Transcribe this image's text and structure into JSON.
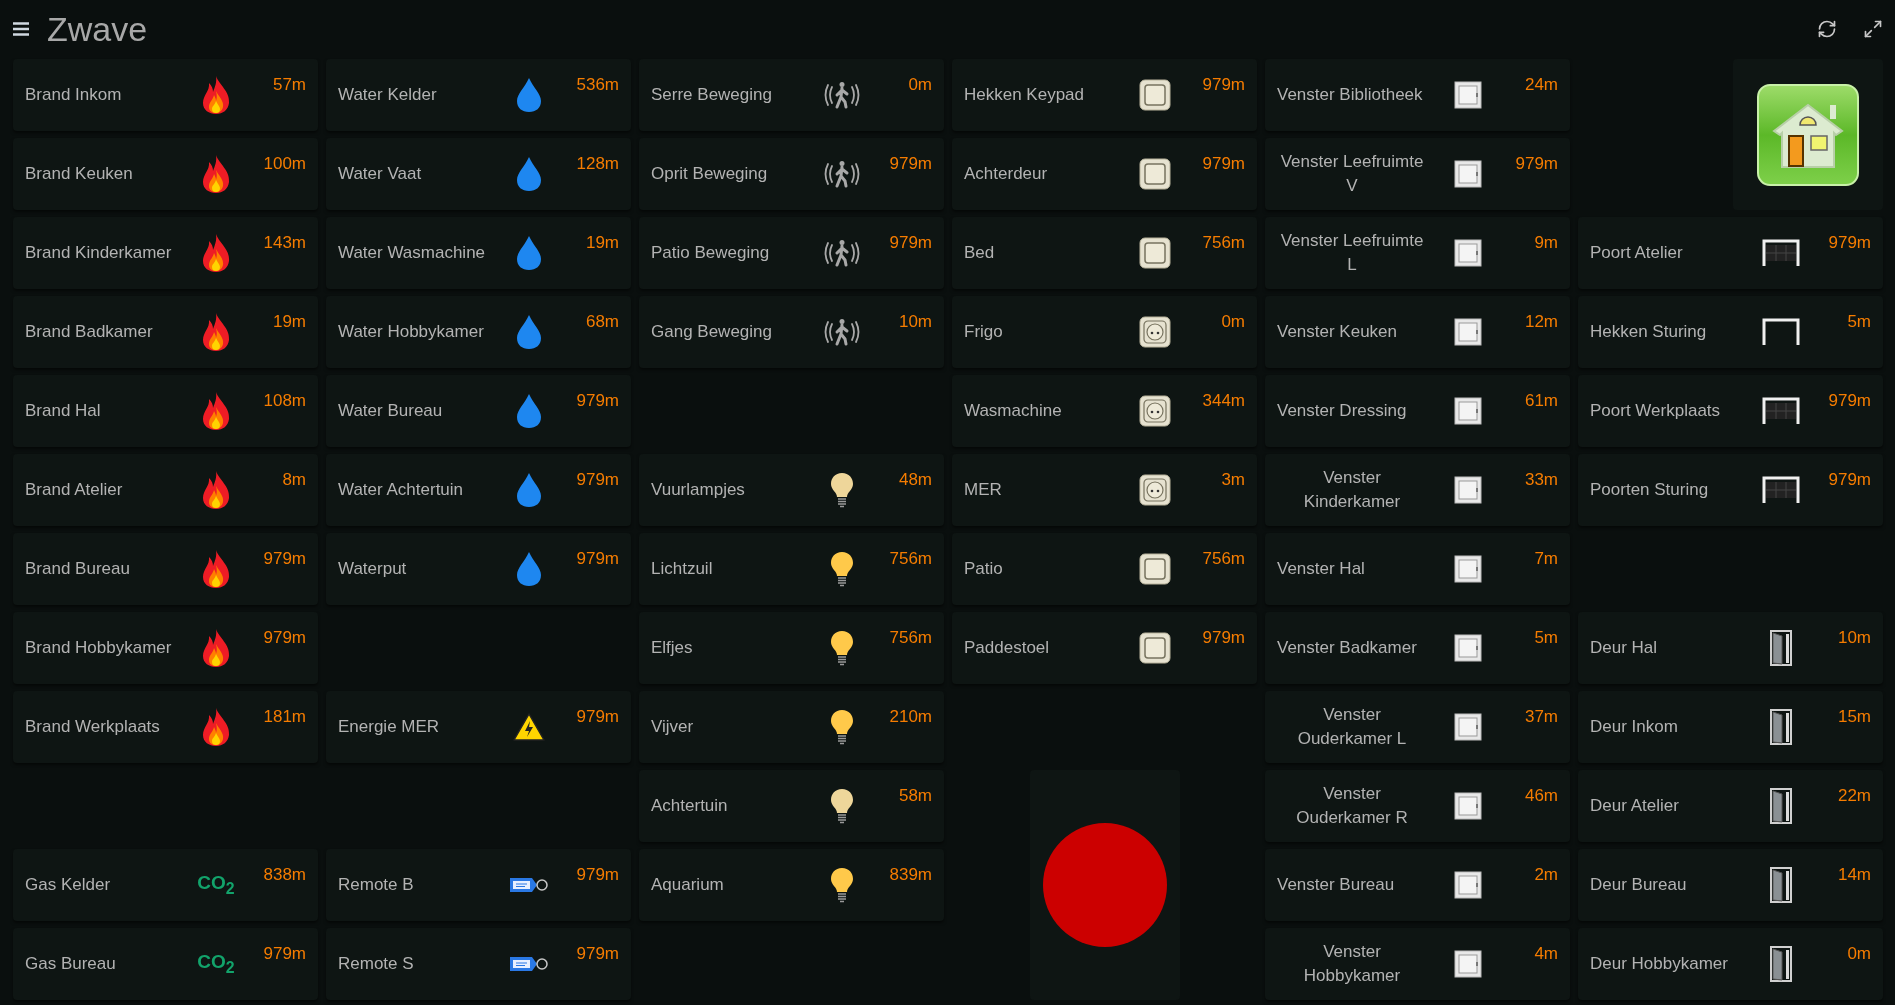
{
  "header": {
    "title": "Zwave"
  },
  "columns": [
    {
      "tiles": [
        {
          "kind": "fire",
          "name": "Brand Inkom",
          "value": "57m"
        },
        {
          "kind": "fire",
          "name": "Brand Keuken",
          "value": "100m"
        },
        {
          "kind": "fire",
          "name": "Brand Kinderkamer",
          "value": "143m"
        },
        {
          "kind": "fire",
          "name": "Brand Badkamer",
          "value": "19m"
        },
        {
          "kind": "fire",
          "name": "Brand Hal",
          "value": "108m"
        },
        {
          "kind": "fire",
          "name": "Brand Atelier",
          "value": "8m"
        },
        {
          "kind": "fire",
          "name": "Brand Bureau",
          "value": "979m"
        },
        {
          "kind": "fire",
          "name": "Brand Hobbykamer",
          "value": "979m"
        },
        {
          "kind": "fire",
          "name": "Brand Werkplaats",
          "value": "181m"
        },
        {
          "kind": "blank"
        },
        {
          "kind": "co2",
          "name": "Gas Kelder",
          "value": "838m",
          "icon_text": "CO$_{2}$"
        },
        {
          "kind": "co2",
          "name": "Gas Bureau",
          "value": "979m",
          "icon_text": "CO$_{2}$"
        }
      ]
    },
    {
      "tiles": [
        {
          "kind": "water",
          "name": "Water Kelder",
          "value": "536m"
        },
        {
          "kind": "water",
          "name": "Water Vaat",
          "value": "128m"
        },
        {
          "kind": "water",
          "name": "Water Wasmachine",
          "value": "19m"
        },
        {
          "kind": "water",
          "name": "Water Hobbykamer",
          "value": "68m"
        },
        {
          "kind": "water",
          "name": "Water Bureau",
          "value": "979m"
        },
        {
          "kind": "water",
          "name": "Water Achtertuin",
          "value": "979m"
        },
        {
          "kind": "water",
          "name": "Waterput",
          "value": "979m"
        },
        {
          "kind": "blank"
        },
        {
          "kind": "energy",
          "name": "Energie MER",
          "value": "979m"
        },
        {
          "kind": "blank"
        },
        {
          "kind": "remote",
          "name": "Remote B",
          "value": "979m"
        },
        {
          "kind": "remote",
          "name": "Remote S",
          "value": "979m"
        }
      ]
    },
    {
      "tiles": [
        {
          "kind": "motion",
          "name": "Serre Beweging",
          "value": "0m"
        },
        {
          "kind": "motion",
          "name": "Oprit Beweging",
          "value": "979m"
        },
        {
          "kind": "motion",
          "name": "Patio Beweging",
          "value": "979m"
        },
        {
          "kind": "motion",
          "name": "Gang Beweging",
          "value": "10m"
        },
        {
          "kind": "blank"
        },
        {
          "kind": "bulb",
          "name": "Vuurlampjes",
          "value": "48m",
          "on": false
        },
        {
          "kind": "bulb",
          "name": "Lichtzuil",
          "value": "756m",
          "on": true
        },
        {
          "kind": "bulb",
          "name": "Elfjes",
          "value": "756m",
          "on": true
        },
        {
          "kind": "bulb",
          "name": "Vijver",
          "value": "210m",
          "on": true
        },
        {
          "kind": "bulb",
          "name": "Achtertuin",
          "value": "58m",
          "on": false
        },
        {
          "kind": "bulb",
          "name": "Aquarium",
          "value": "839m",
          "on": true
        }
      ]
    },
    {
      "tiles": [
        {
          "kind": "switch",
          "name": "Hekken Keypad",
          "value": "979m"
        },
        {
          "kind": "switch",
          "name": "Achterdeur",
          "value": "979m"
        },
        {
          "kind": "switch",
          "name": "Bed",
          "value": "756m"
        },
        {
          "kind": "socket",
          "name": "Frigo",
          "value": "0m"
        },
        {
          "kind": "socket",
          "name": "Wasmachine",
          "value": "344m"
        },
        {
          "kind": "socket",
          "name": "MER",
          "value": "3m"
        },
        {
          "kind": "switch",
          "name": "Patio",
          "value": "756m"
        },
        {
          "kind": "switch",
          "name": "Paddestoel",
          "value": "979m"
        },
        {
          "kind": "blank"
        },
        {
          "kind": "alarm"
        }
      ]
    },
    {
      "tiles": [
        {
          "kind": "window",
          "name": "Venster Bibliotheek",
          "value": "24m"
        },
        {
          "kind": "window",
          "name": "Venster Leefruimte V",
          "value": "979m"
        },
        {
          "kind": "window",
          "name": "Venster Leefruimte L",
          "value": "9m"
        },
        {
          "kind": "window",
          "name": "Venster Keuken",
          "value": "12m"
        },
        {
          "kind": "window",
          "name": "Venster Dressing",
          "value": "61m"
        },
        {
          "kind": "window",
          "name": "Venster Kinderkamer",
          "value": "33m"
        },
        {
          "kind": "window",
          "name": "Venster Hal",
          "value": "7m"
        },
        {
          "kind": "window",
          "name": "Venster Badkamer",
          "value": "5m"
        },
        {
          "kind": "window",
          "name": "Venster Ouderkamer L",
          "value": "37m"
        },
        {
          "kind": "window",
          "name": "Venster Ouderkamer R",
          "value": "46m"
        },
        {
          "kind": "window",
          "name": "Venster Bureau",
          "value": "2m"
        },
        {
          "kind": "window",
          "name": "Venster Hobbykamer",
          "value": "4m"
        }
      ]
    },
    {
      "tiles": [
        {
          "kind": "home"
        },
        {
          "kind": "garage",
          "name": "Poort Atelier",
          "value": "979m"
        },
        {
          "kind": "gate",
          "name": "Hekken Sturing",
          "value": "5m"
        },
        {
          "kind": "garage",
          "name": "Poort Werkplaats",
          "value": "979m"
        },
        {
          "kind": "garage",
          "name": "Poorten Sturing",
          "value": "979m"
        },
        {
          "kind": "blank"
        },
        {
          "kind": "door",
          "name": "Deur Hal",
          "value": "10m"
        },
        {
          "kind": "door",
          "name": "Deur Inkom",
          "value": "15m"
        },
        {
          "kind": "door",
          "name": "Deur Atelier",
          "value": "22m"
        },
        {
          "kind": "door",
          "name": "Deur Bureau",
          "value": "14m"
        },
        {
          "kind": "door",
          "name": "Deur Hobbykamer",
          "value": "0m"
        }
      ]
    }
  ]
}
